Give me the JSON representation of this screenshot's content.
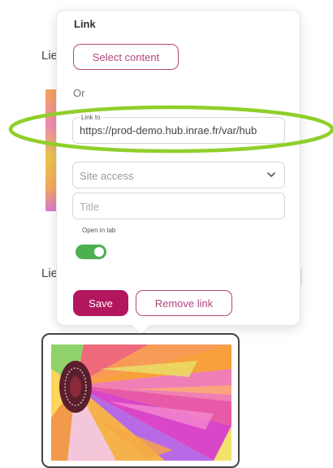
{
  "background": {
    "label_top": "Lie",
    "label_bottom": "Lie"
  },
  "popover": {
    "title": "Link",
    "select_content_label": "Select content",
    "or_label": "Or",
    "link_field": {
      "label": "Link to",
      "value": "https://prod-demo.hub.inrae.fr/var/hub"
    },
    "site_access": {
      "placeholder": "Site access",
      "icon": "chevron-down-icon"
    },
    "title_field": {
      "placeholder": "Title"
    },
    "open_in_tab": {
      "label": "Open in tab",
      "enabled": true
    },
    "save_label": "Save",
    "remove_link_label": "Remove link"
  },
  "colors": {
    "accent": "#b2175e",
    "outline_accent": "#b5457e",
    "toggle_on": "#4caf50",
    "annotation": "#8fcf2a"
  },
  "annotation": {
    "shape": "ellipse",
    "highlights": "link_field"
  },
  "image_card": {
    "content": "colorful abstract flower image"
  }
}
